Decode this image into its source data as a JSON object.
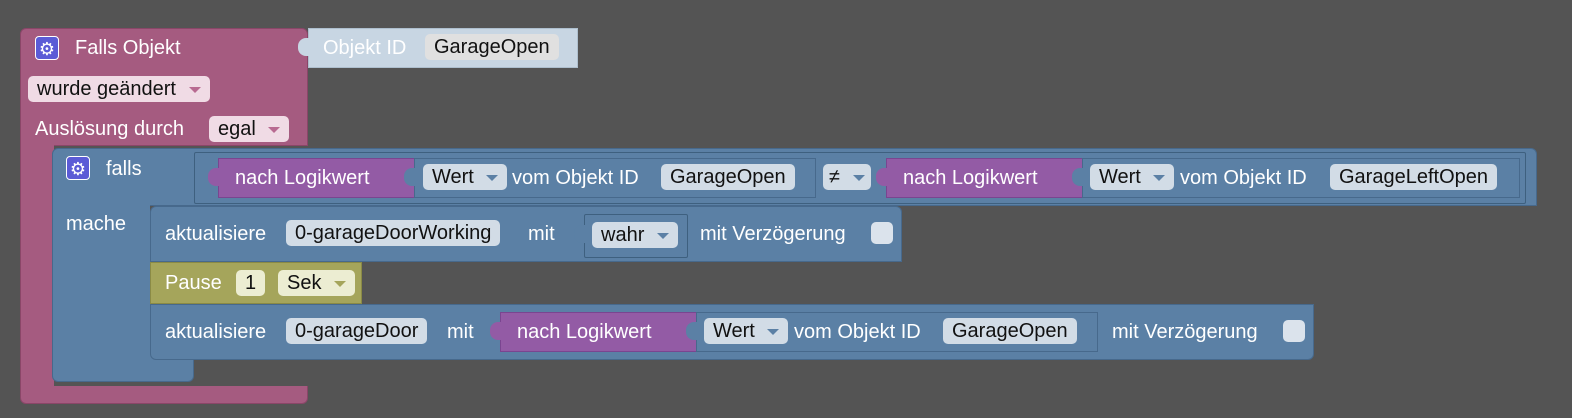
{
  "event_block": {
    "title": "Falls Objekt",
    "object_label": "Objekt ID",
    "object_id": "GarageOpen",
    "change_option": "wurde geändert",
    "trigger_label": "Auslösung durch",
    "trigger_option": "egal"
  },
  "if_block": {
    "if_label": "falls",
    "do_label": "mache",
    "left": {
      "convert_label": "nach Logikwert",
      "prop_option": "Wert",
      "from_label": "vom Objekt ID",
      "object_id": "GarageOpen"
    },
    "operator": "≠",
    "right": {
      "convert_label": "nach Logikwert",
      "prop_option": "Wert",
      "from_label": "vom Objekt ID",
      "object_id": "GarageLeftOpen"
    }
  },
  "update1": {
    "label": "aktualisiere",
    "object_id": "0-garageDoorWorking",
    "with_label": "mit",
    "value_option": "wahr",
    "delay_label": "mit Verzögerung"
  },
  "pause": {
    "label": "Pause",
    "value": "1",
    "unit_option": "Sek"
  },
  "update2": {
    "label": "aktualisiere",
    "object_id": "0-garageDoor",
    "with_label": "mit",
    "convert_label": "nach Logikwert",
    "prop_option": "Wert",
    "from_label": "vom Objekt ID",
    "source_object_id": "GarageOpen",
    "delay_label": "mit Verzögerung"
  },
  "colors": {
    "workspace": "#545454",
    "event_block": "#a55b80",
    "logic_block": "#5b80a5",
    "convert_block": "#935ba5",
    "pause_block": "#a5a55b",
    "object_block": "#c8d6e3"
  }
}
